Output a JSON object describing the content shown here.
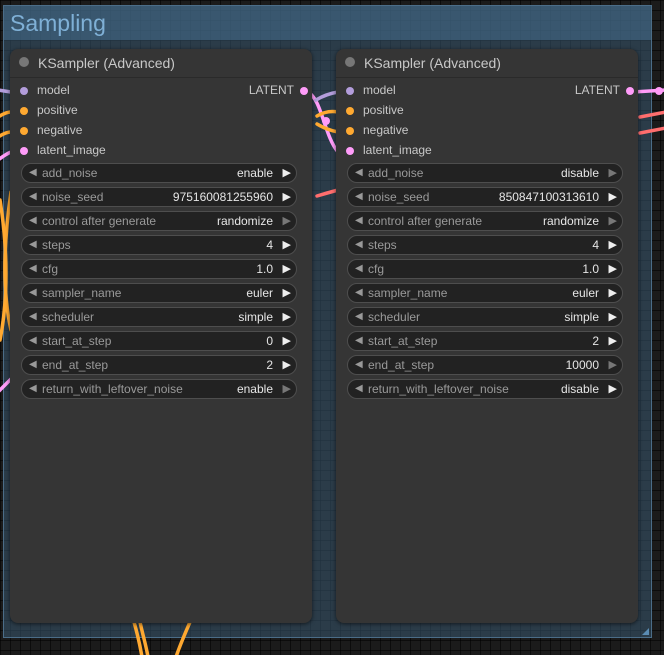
{
  "group": {
    "title": "Sampling"
  },
  "colors": {
    "model": "#b39ddb",
    "conditioning": "#ffa931",
    "latent": "#ff9cf9",
    "wire_model": "#b39ddb",
    "wire_conditioning": "#ffa931",
    "wire_latent": "#ff9cf9",
    "wire_red": "#ff6e6e"
  },
  "nodes": [
    {
      "title": "KSampler (Advanced)",
      "inputs": [
        "model",
        "positive",
        "negative",
        "latent_image"
      ],
      "output": "LATENT",
      "widgets": [
        {
          "label": "add_noise",
          "value": "enable"
        },
        {
          "label": "noise_seed",
          "value": "975160081255960"
        },
        {
          "label": "control after generate",
          "value": "randomize"
        },
        {
          "label": "steps",
          "value": "4"
        },
        {
          "label": "cfg",
          "value": "1.0"
        },
        {
          "label": "sampler_name",
          "value": "euler"
        },
        {
          "label": "scheduler",
          "value": "simple"
        },
        {
          "label": "start_at_step",
          "value": "0"
        },
        {
          "label": "end_at_step",
          "value": "2"
        },
        {
          "label": "return_with_leftover_noise",
          "value": "enable"
        }
      ]
    },
    {
      "title": "KSampler (Advanced)",
      "inputs": [
        "model",
        "positive",
        "negative",
        "latent_image"
      ],
      "output": "LATENT",
      "widgets": [
        {
          "label": "add_noise",
          "value": "disable"
        },
        {
          "label": "noise_seed",
          "value": "850847100313610"
        },
        {
          "label": "control after generate",
          "value": "randomize"
        },
        {
          "label": "steps",
          "value": "4"
        },
        {
          "label": "cfg",
          "value": "1.0"
        },
        {
          "label": "sampler_name",
          "value": "euler"
        },
        {
          "label": "scheduler",
          "value": "simple"
        },
        {
          "label": "start_at_step",
          "value": "2"
        },
        {
          "label": "end_at_step",
          "value": "10000"
        },
        {
          "label": "return_with_leftover_noise",
          "value": "disable"
        }
      ]
    }
  ]
}
